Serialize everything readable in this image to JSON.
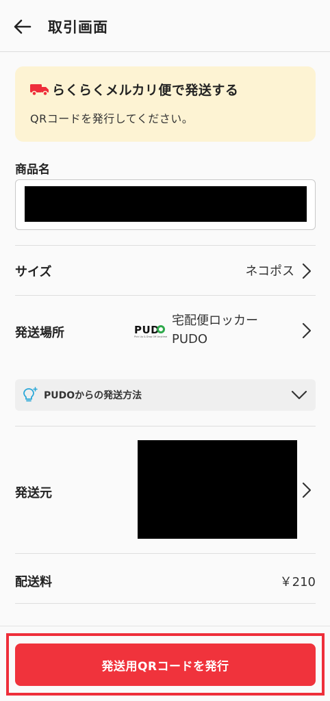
{
  "header": {
    "title": "取引画面"
  },
  "notice": {
    "title": "らくらくメルカリ便で発送する",
    "text": "QRコードを発行してください。"
  },
  "product": {
    "label": "商品名"
  },
  "size": {
    "label": "サイズ",
    "value": "ネコポス"
  },
  "place": {
    "label": "発送場所",
    "logo_text": "PUD",
    "logo_sub": "Pick Up & Drop Off Anytime",
    "value_line1": "宅配便ロッカー",
    "value_line2": "PUDO"
  },
  "howto": {
    "label": "PUDOからの発送方法"
  },
  "origin": {
    "label": "発送元"
  },
  "fee": {
    "label": "配送料",
    "value": "￥210"
  },
  "action": {
    "issue_label": "発送用QRコードを発行"
  },
  "colors": {
    "accent": "#f0333c",
    "notice_bg": "#fdf3d3",
    "pudo_green": "#2da84a"
  }
}
